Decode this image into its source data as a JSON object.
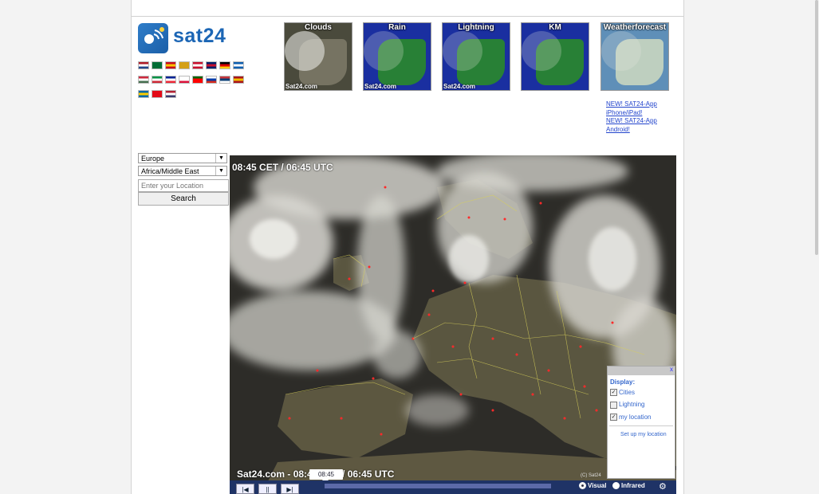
{
  "header": {
    "logo_text": "sat24"
  },
  "flags": [
    [
      "#ae1c28",
      "#fff",
      "#21468b"
    ],
    [
      "#006c35",
      "#006c35",
      "#006c35"
    ],
    [
      "#c60b1e",
      "#ffc400",
      "#c60b1e"
    ],
    [
      "#d4a017",
      "#d4a017",
      "#d4a017"
    ],
    [
      "#c8102e",
      "#fff",
      "#c8102e"
    ],
    [
      "#012169",
      "#c8102e",
      "#012169"
    ],
    [
      "#000",
      "#dd0000",
      "#ffce00"
    ],
    [
      "#0d5eaf",
      "#fff",
      "#0d5eaf"
    ],
    [
      "#cd2a3e",
      "#fff",
      "#477050"
    ],
    [
      "#009246",
      "#fff",
      "#ce2b37"
    ],
    [
      "#002395",
      "#fff",
      "#ed2939"
    ],
    [
      "#fff",
      "#fff",
      "#dc143c"
    ],
    [
      "#006600",
      "#ff0000",
      "#ff0000"
    ],
    [
      "#fff",
      "#0039a6",
      "#d52b1e"
    ],
    [
      "#c6363c",
      "#0c4076",
      "#fff"
    ],
    [
      "#aa151b",
      "#f1bf00",
      "#aa151b"
    ],
    [
      "#006aa7",
      "#fecc00",
      "#006aa7"
    ],
    [
      "#e30a17",
      "#e30a17",
      "#e30a17"
    ],
    [
      "#b22234",
      "#fff",
      "#3c3b6e"
    ]
  ],
  "thumbnails": [
    {
      "title": "Clouds",
      "footer": "Sat24.com",
      "bg": "#4a4a3c"
    },
    {
      "title": "Rain",
      "footer": "Sat24.com",
      "bg": "#1a2fa0"
    },
    {
      "title": "Lightning",
      "footer": "Sat24.com",
      "bg": "#1a2fa0"
    },
    {
      "title": "KM",
      "footer": "",
      "bg": "#1a2fa0"
    },
    {
      "title": "Weatherforecast",
      "footer": "",
      "bg": "#5f8fb8"
    }
  ],
  "app_links": [
    {
      "label": "NEW! SAT24-App"
    },
    {
      "label": "iPhone/iPad!"
    },
    {
      "label": "NEW! SAT24-App"
    },
    {
      "label": "Android!"
    }
  ],
  "sidebar": {
    "region_select_1": "Europe",
    "region_select_2": "Africa/Middle East",
    "location_placeholder": "Enter your Location",
    "search_label": "Search"
  },
  "map": {
    "time_header": "08:45 CET / 06:45 UTC",
    "footer_text": "Sat24.com - 08:45 CET / 06:45 UTC",
    "copyright": "(C) Sat24",
    "timeline_time": "08:45"
  },
  "controls": {
    "prev": "|◀",
    "pause": "||",
    "next": "▶|",
    "visual_label": "Visual",
    "infrared_label": "Infrared"
  },
  "display_panel": {
    "close": "x",
    "title": "Display:",
    "options": [
      {
        "label": "Cities",
        "checked": true
      },
      {
        "label": "Lightning",
        "checked": false
      },
      {
        "label": "my location",
        "checked": true
      }
    ],
    "setup_link": "Set up my location"
  }
}
